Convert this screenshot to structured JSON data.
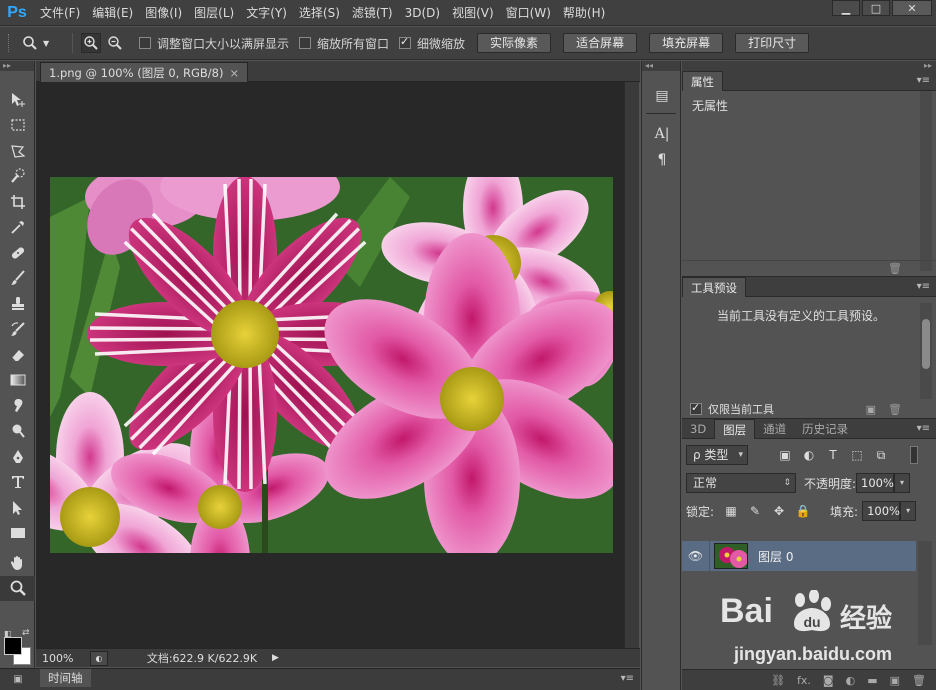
{
  "app": {
    "logo": "Ps",
    "menu": [
      "文件(F)",
      "编辑(E)",
      "图像(I)",
      "图层(L)",
      "文字(Y)",
      "选择(S)",
      "滤镜(T)",
      "3D(D)",
      "视图(V)",
      "窗口(W)",
      "帮助(H)"
    ],
    "window_buttons": [
      "minimize-icon",
      "maximize-icon",
      "close-icon"
    ]
  },
  "options_bar": {
    "checkboxes": [
      {
        "label": "调整窗口大小以满屏显示",
        "checked": false
      },
      {
        "label": "缩放所有窗口",
        "checked": false
      },
      {
        "label": "细微缩放",
        "checked": true
      }
    ],
    "buttons": [
      "实际像素",
      "适合屏幕",
      "填充屏幕",
      "打印尺寸"
    ]
  },
  "document": {
    "tab_title": "1.png @ 100% (图层 0, RGB/8)",
    "tab_close": "×"
  },
  "status_bar": {
    "zoom": "100%",
    "doc_info": "文档:622.9 K/622.9K"
  },
  "timeline": {
    "label": "时间轴"
  },
  "properties_panel": {
    "tab": "属性",
    "content": "无属性"
  },
  "tool_presets_panel": {
    "tab": "工具预设",
    "content": "当前工具没有定义的工具预设。",
    "checkbox_label": "仅限当前工具",
    "checkbox_checked": true
  },
  "layers_panel": {
    "tabs": [
      "3D",
      "图层",
      "通道",
      "历史记录"
    ],
    "active_tab": "图层",
    "filter_label": "ρ 类型",
    "blend_mode": "正常",
    "opacity_label": "不透明度:",
    "opacity_value": "100%",
    "lock_label": "锁定:",
    "fill_label": "填充:",
    "fill_value": "100%",
    "layers": [
      {
        "name": "图层 0",
        "visible": true,
        "selected": true
      }
    ],
    "footer_icons": [
      "link-icon",
      "fx-icon",
      "mask-icon",
      "adjustment-icon",
      "folder-icon",
      "new-layer-icon",
      "trash-icon"
    ],
    "footer_fx": "fx."
  },
  "watermark": {
    "brand": "Bai",
    "brand2": "经验",
    "url": "jingyan.baidu.com"
  }
}
